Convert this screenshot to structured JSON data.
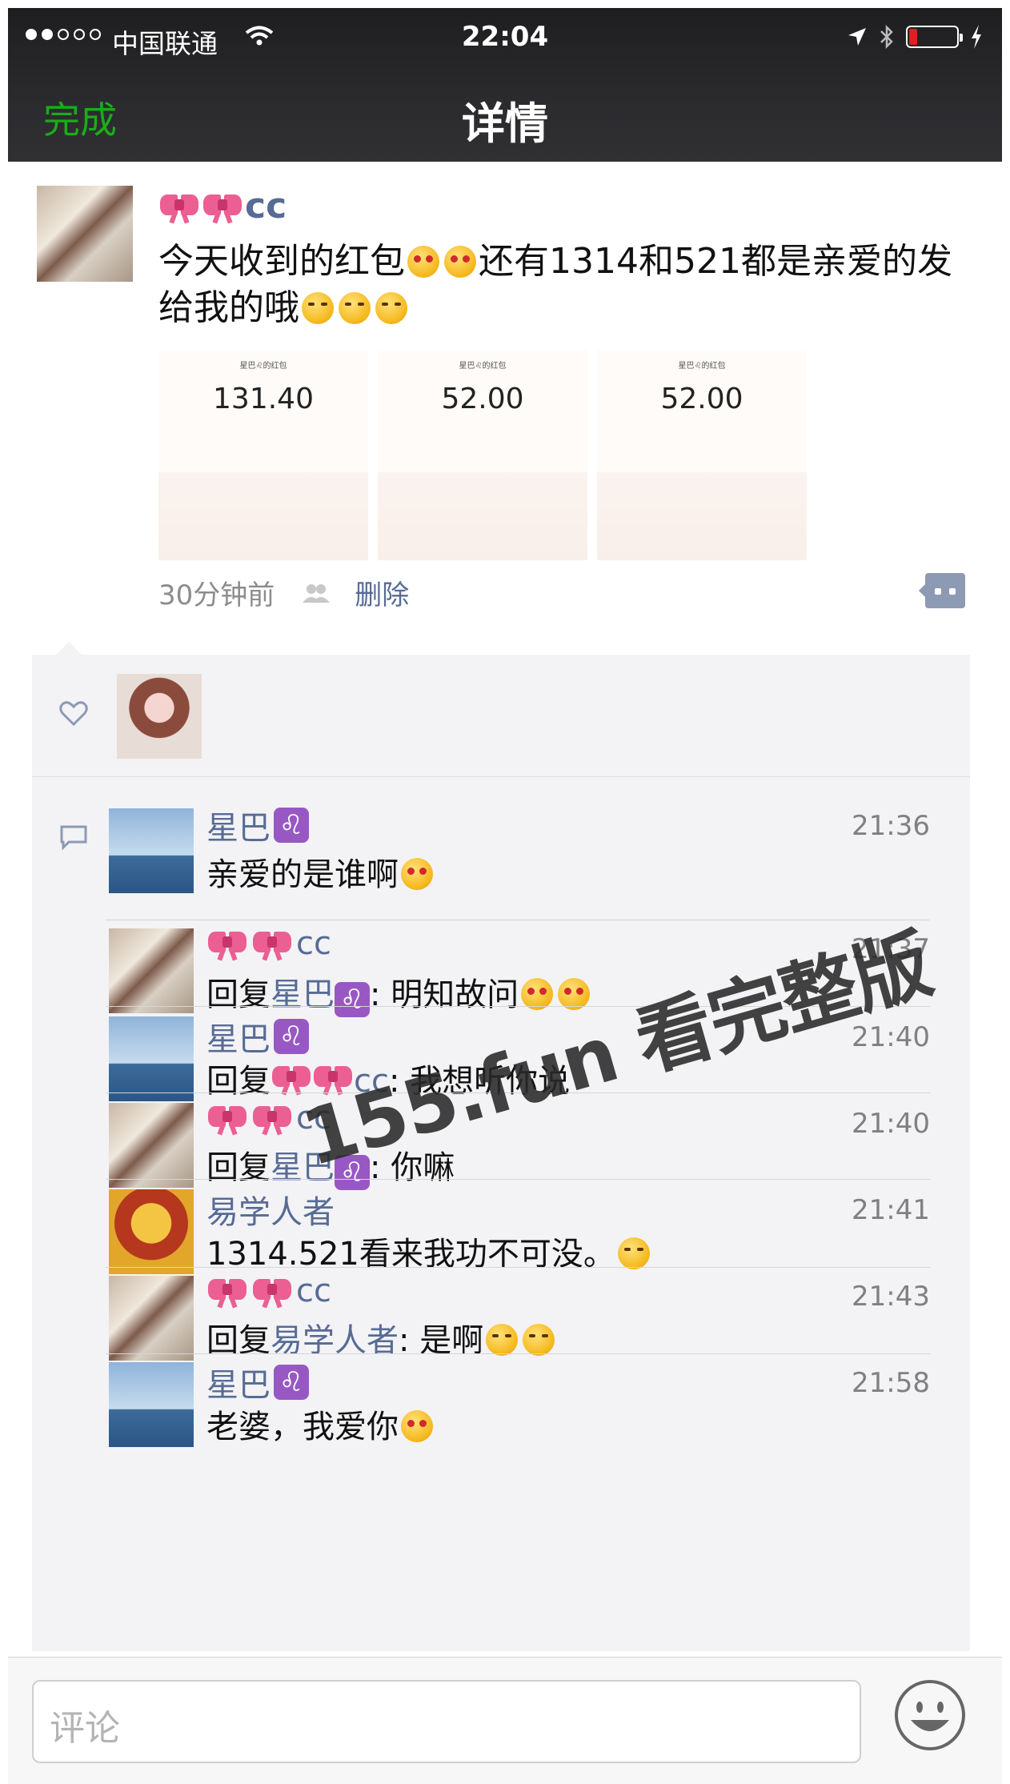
{
  "status_bar": {
    "carrier": "中国联通",
    "time": "22:04"
  },
  "nav": {
    "done_label": "完成",
    "title": "详情"
  },
  "post": {
    "author_suffix": "cc",
    "text_part1": "今天收到的红包",
    "text_part2": "还有1314和521都是亲爱的发给我的哦",
    "images": [
      {
        "title": "星巴♌的红包",
        "amount": "131.40"
      },
      {
        "title": "星巴♌的红包",
        "amount": "52.00"
      },
      {
        "title": "星巴♌的红包",
        "amount": "52.00"
      }
    ],
    "time_ago": "30分钟前",
    "delete_label": "删除"
  },
  "comments": [
    {
      "name": "星巴",
      "time": "21:36",
      "text": "亲爱的是谁啊",
      "reply_to": ""
    },
    {
      "name": "cc",
      "time": "21:37",
      "reply_prefix": "回复",
      "reply_to": "星巴",
      "text": ": 明知故问"
    },
    {
      "name": "星巴",
      "time": "21:40",
      "reply_prefix": "回复",
      "reply_to": "cc",
      "text": ": 我想听你说"
    },
    {
      "name": "cc",
      "time": "21:40",
      "reply_prefix": "回复",
      "reply_to": "星巴",
      "text": ": 你嘛"
    },
    {
      "name": "易学人者",
      "time": "21:41",
      "text": "1314.521看来我功不可没。"
    },
    {
      "name": "cc",
      "time": "21:43",
      "reply_prefix": "回复",
      "reply_to": "易学人者",
      "text": ": 是啊"
    },
    {
      "name": "星巴",
      "time": "21:58",
      "text": "老婆，我爱你"
    }
  ],
  "input": {
    "placeholder": "评论"
  },
  "watermark": "155.fun 看完整版",
  "colors": {
    "link": "#576b95",
    "done_green": "#1aad19",
    "panel_bg": "#f3f3f5"
  },
  "icons": [
    "wifi-icon",
    "location-arrow-icon",
    "bluetooth-icon",
    "battery-icon",
    "charging-icon",
    "heart-icon",
    "comment-icon",
    "friends-icon",
    "more-icon",
    "emoji-icon",
    "leo-icon",
    "bow-icon"
  ]
}
